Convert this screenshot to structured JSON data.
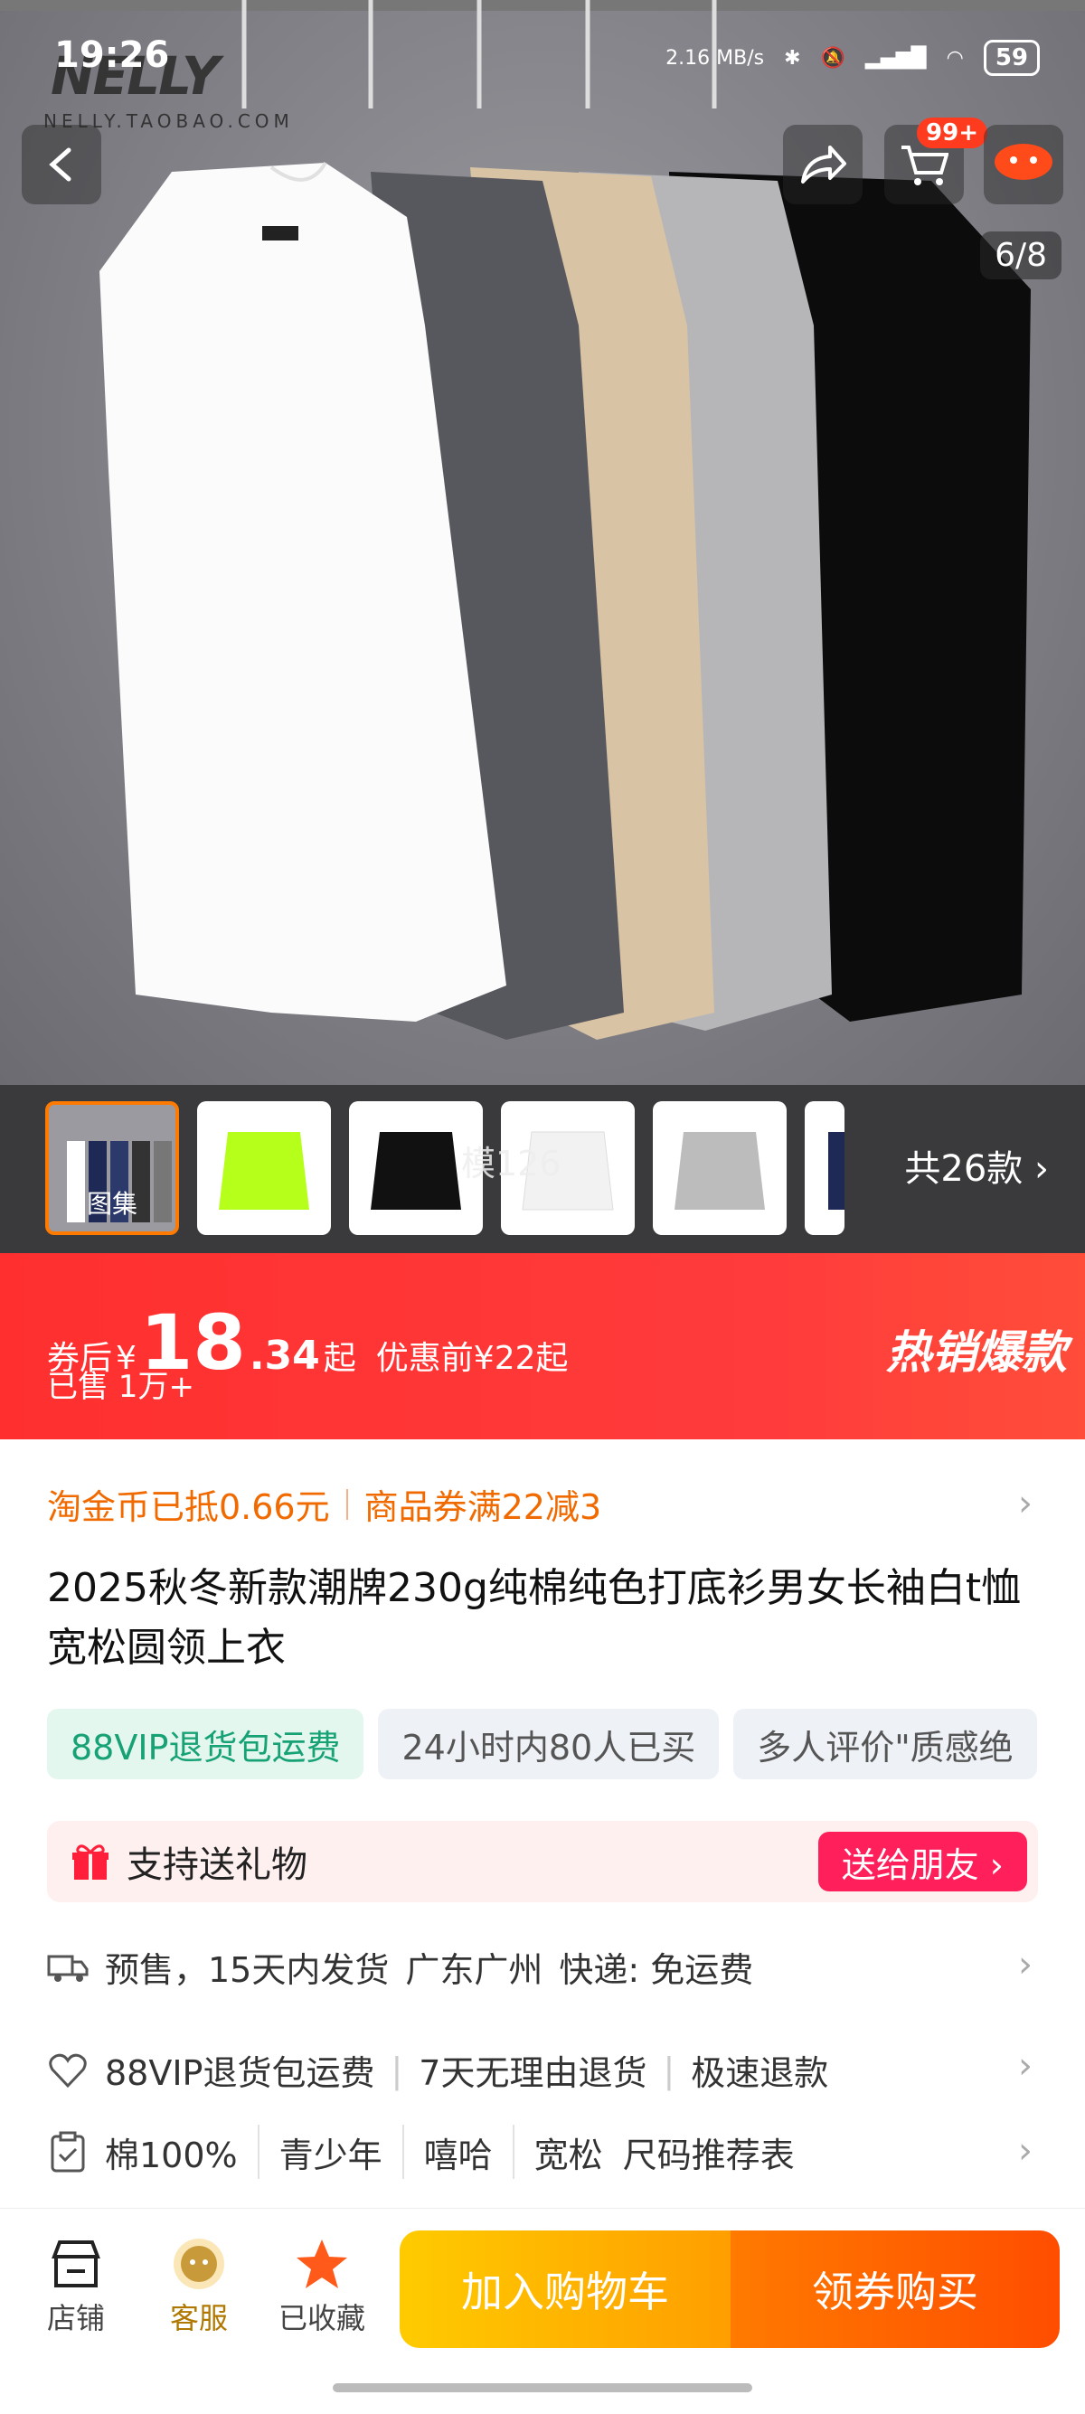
{
  "status_bar": {
    "time": "19:26",
    "net_speed": "2.16 MB/s",
    "battery": "59"
  },
  "brand": {
    "logo": "NELLY",
    "sub": "NELLY.TAOBAO.COM"
  },
  "header": {
    "cart_badge": "99+",
    "image_counter": "6/8"
  },
  "thumbnails": {
    "first_label": "图集",
    "overlay_text": "模126",
    "more_label": "共26款"
  },
  "price": {
    "prefix": "券后",
    "currency": "¥",
    "integer": "18",
    "decimal": ".34",
    "suffix": "起",
    "original": "优惠前¥22起",
    "sold": "已售 1万+",
    "hot_label": "热销爆款"
  },
  "coupons": {
    "coin": "淘金币已抵0.66元",
    "coupon": "商品券满22减3"
  },
  "product": {
    "title": "2025秋冬新款潮牌230g纯棉纯色打底衫男女长袖白t恤宽松圆领上衣"
  },
  "tags": [
    "88VIP退货包运费",
    "24小时内80人已买",
    "多人评价\"质感绝"
  ],
  "gift": {
    "label": "支持送礼物",
    "button": "送给朋友 ›"
  },
  "shipping": {
    "presale": "预售，15天内发货",
    "origin": "广东广州",
    "express": "快递: 免运费"
  },
  "service": {
    "items": [
      "88VIP退货包运费",
      "7天无理由退货",
      "极速退款"
    ]
  },
  "specs": {
    "items": [
      "棉100%",
      "青少年",
      "嘻哈",
      "宽松",
      "尺码推荐表"
    ]
  },
  "bottom_bar": {
    "shop": "店铺",
    "service": "客服",
    "favorited": "已收藏",
    "add_cart": "加入购物车",
    "buy": "领券购买"
  },
  "colors": {
    "accent_red": "#ff2f2f",
    "orange": "#ff7a00",
    "green_tag": "#17a276"
  }
}
